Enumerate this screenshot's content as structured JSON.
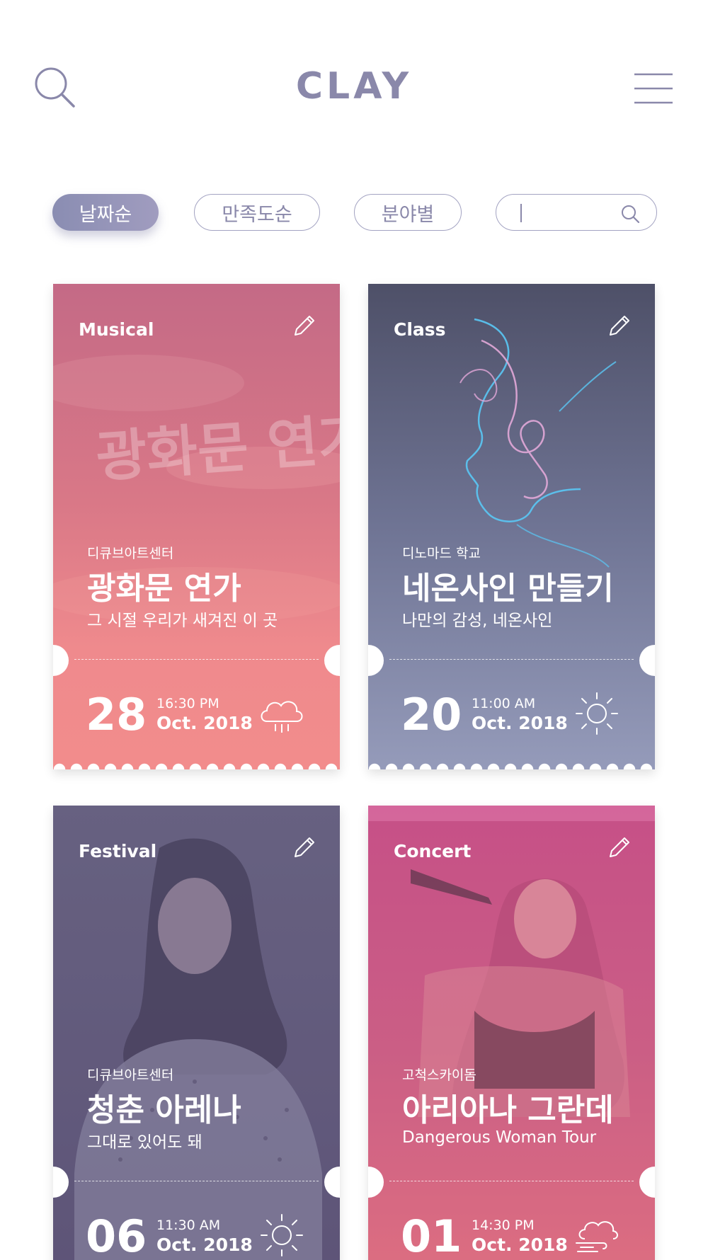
{
  "app": {
    "logo": "CLAY"
  },
  "header": {
    "search_icon": "search-icon",
    "menu_icon": "hamburger-menu-icon"
  },
  "filters": {
    "sort_by_date": "날짜순",
    "sort_by_rating": "만족도순",
    "sort_by_field": "분야별",
    "search_value": "",
    "search_icon": "search-icon"
  },
  "colors": {
    "brand": "#8a88aa",
    "musical": "#f28c8c",
    "class": "#9298b8",
    "festival": "#6a5f86",
    "concert": "#e0717e"
  },
  "cards": [
    {
      "category": "Musical",
      "venue": "디큐브아트센터",
      "title": "광화문 연가",
      "subtitle": "그 시절 우리가 새겨진 이 곳",
      "day": "28",
      "time": "16:30 PM",
      "date": "Oct. 2018",
      "weather_icon": "rain-cloud-icon",
      "poster_text": "광화문 연가"
    },
    {
      "category": "Class",
      "venue": "디노마드 학교",
      "title": "네온사인 만들기",
      "subtitle": "나만의 감성, 네온사인",
      "day": "20",
      "time": "11:00 AM",
      "date": "Oct. 2018",
      "weather_icon": "sun-icon"
    },
    {
      "category": "Festival",
      "venue": "디큐브아트센터",
      "title": "청춘 아레나",
      "subtitle": "그대로 있어도 돼",
      "day": "06",
      "time": "11:30 AM",
      "date": "Oct. 2018",
      "weather_icon": "sun-icon"
    },
    {
      "category": "Concert",
      "venue": "고척스카이돔",
      "title": "아리아나 그란데",
      "subtitle": "Dangerous Woman Tour",
      "day": "01",
      "time": "14:30 PM",
      "date": "Oct. 2018",
      "weather_icon": "wind-cloud-icon"
    }
  ]
}
